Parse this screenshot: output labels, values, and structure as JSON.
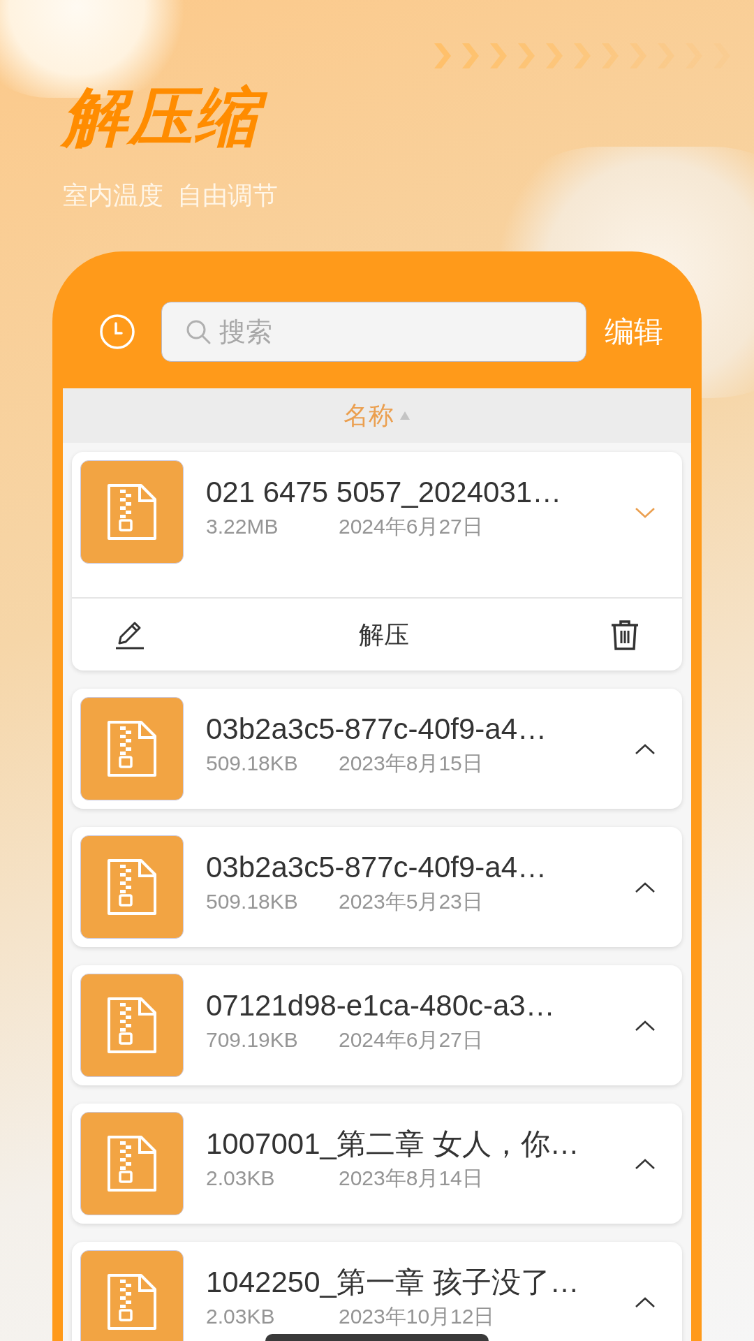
{
  "banner": {
    "title": "解压缩",
    "subtitle": "室内温度  自由调节"
  },
  "toolbar": {
    "search": {
      "placeholder": "搜索"
    },
    "edit_button": "编辑"
  },
  "sort_header": {
    "label": "名称",
    "ascending": true
  },
  "files": [
    {
      "name": "021 6475 5057_2024031…",
      "size": "3.22MB",
      "date": "2024年6月27日",
      "expanded": true,
      "actions": {
        "extract": "解压"
      }
    },
    {
      "name": "03b2a3c5-877c-40f9-a4…",
      "size": "509.18KB",
      "date": "2023年8月15日",
      "expanded": false
    },
    {
      "name": "03b2a3c5-877c-40f9-a4…",
      "size": "509.18KB",
      "date": "2023年5月23日",
      "expanded": false
    },
    {
      "name": "07121d98-e1ca-480c-a3…",
      "size": "709.19KB",
      "date": "2024年6月27日",
      "expanded": false
    },
    {
      "name": "1007001_第二章 女人，你…",
      "size": "2.03KB",
      "date": "2023年8月14日",
      "expanded": false
    },
    {
      "name": "1042250_第一章 孩子没了…",
      "size": "2.03KB",
      "date": "2023年10月12日",
      "expanded": false
    }
  ]
}
